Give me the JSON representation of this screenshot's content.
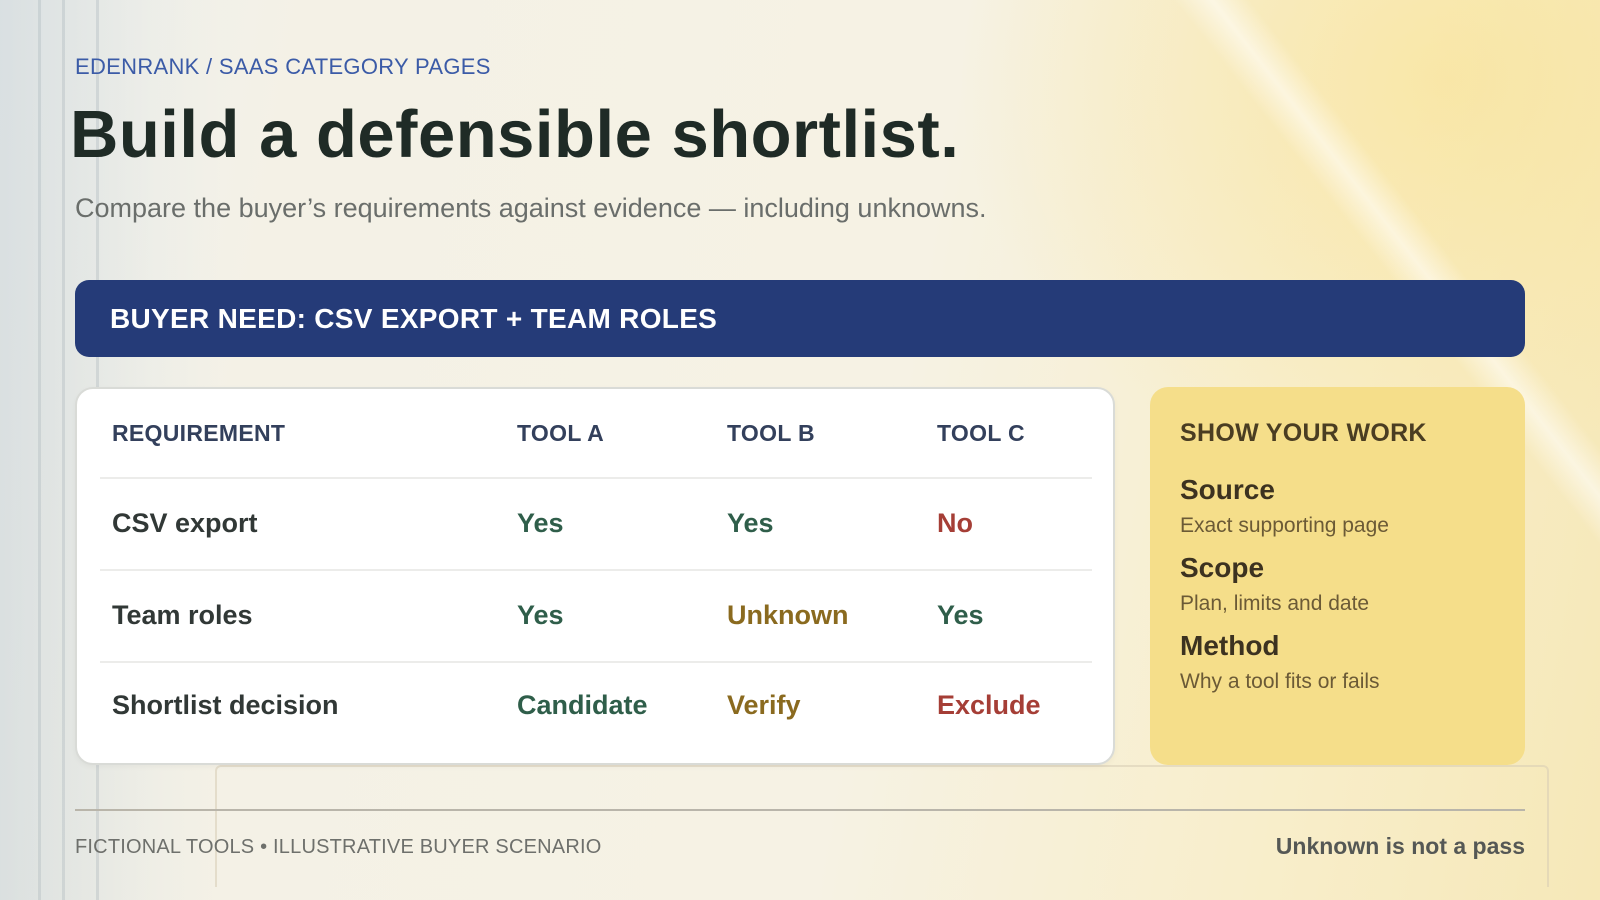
{
  "breadcrumb": "EDENRANK / SAAS CATEGORY PAGES",
  "title": "Build a defensible shortlist.",
  "subtitle": "Compare the buyer’s requirements against evidence — including unknowns.",
  "banner": {
    "label": "BUYER NEED: CSV EXPORT + TEAM ROLES",
    "color": "#253b78"
  },
  "table": {
    "headers": [
      "REQUIREMENT",
      "TOOL A",
      "TOOL B",
      "TOOL C"
    ],
    "rows": [
      {
        "label": "CSV export",
        "values": [
          "Yes",
          "Yes",
          "No"
        ],
        "statuses": [
          "positive",
          "positive",
          "negative"
        ]
      },
      {
        "label": "Team roles",
        "values": [
          "Yes",
          "Unknown",
          "Yes"
        ],
        "statuses": [
          "positive",
          "unknown",
          "positive"
        ]
      },
      {
        "label": "Shortlist decision",
        "values": [
          "Candidate",
          "Verify",
          "Exclude"
        ],
        "statuses": [
          "positive",
          "unknown",
          "negative"
        ]
      }
    ]
  },
  "status_colors": {
    "positive": "#2f5e4a",
    "unknown": "#8a6a1f",
    "negative": "#a53e36"
  },
  "show_your_work": {
    "title": "SHOW YOUR WORK",
    "background": "#f5de8a",
    "items": [
      {
        "name": "Source",
        "desc": "Exact supporting page"
      },
      {
        "name": "Scope",
        "desc": "Plan, limits and date"
      },
      {
        "name": "Method",
        "desc": "Why a tool fits or fails"
      }
    ]
  },
  "footer": {
    "left": "FICTIONAL TOOLS • ILLUSTRATIVE BUYER SCENARIO",
    "right": "Unknown is not a pass"
  }
}
